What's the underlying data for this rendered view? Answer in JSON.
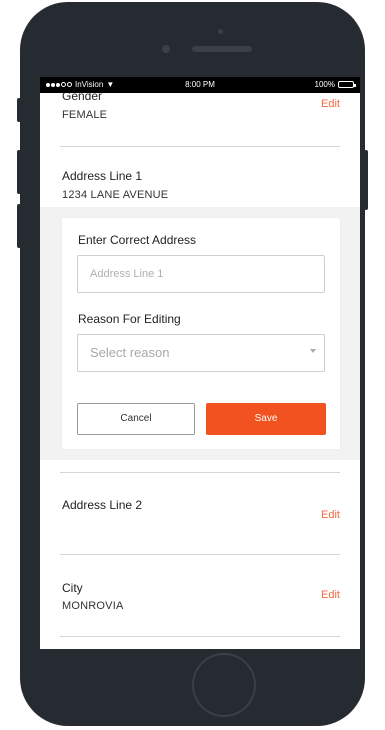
{
  "status_bar": {
    "carrier": "InVision",
    "time": "8:00 PM",
    "battery": "100%"
  },
  "gender": {
    "label": "Gender",
    "value": "FEMALE",
    "edit_label": "Edit"
  },
  "address_line_1": {
    "label": "Address Line 1",
    "value": "1234 LANE AVENUE"
  },
  "edit_form": {
    "title": "Enter Correct Address",
    "address_placeholder": "Address Line 1",
    "reason_label": "Reason For Editing",
    "reason_placeholder": "Select reason",
    "cancel_label": "Cancel",
    "save_label": "Save"
  },
  "address_line_2": {
    "label": "Address Line 2",
    "edit_label": "Edit"
  },
  "city": {
    "label": "City",
    "value": "MONROVIA",
    "edit_label": "Edit"
  },
  "colors": {
    "accent": "#f2521f",
    "edit_link": "#f26a3d",
    "phone_body": "#262a31"
  }
}
